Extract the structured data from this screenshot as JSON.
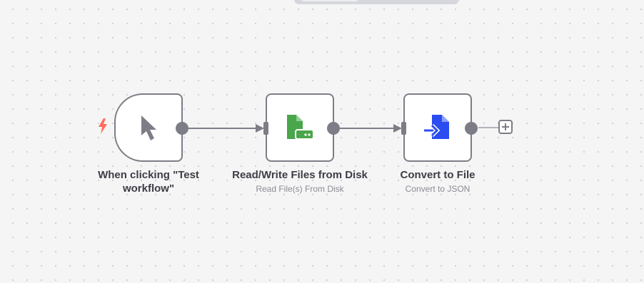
{
  "canvas": {
    "colors": {
      "background": "#f5f5f5",
      "grid_dot": "#cfcfd4",
      "node_border": "#7d7d87",
      "trigger_icon": "#7d7d87",
      "trigger_bolt": "#ff6d5a",
      "read_write_icon": "#4aa64a",
      "convert_icon": "#2a4cf0"
    }
  },
  "nodes": [
    {
      "title": "When clicking \"Test workflow\"",
      "subtitle": "",
      "icon": "cursor-pointer-icon",
      "trigger_icon": "lightning-bolt-icon"
    },
    {
      "title": "Read/Write Files from Disk",
      "subtitle": "Read File(s) From Disk",
      "icon": "file-disk-icon"
    },
    {
      "title": "Convert to File",
      "subtitle": "Convert to JSON",
      "icon": "file-convert-icon"
    }
  ],
  "add_node": {
    "icon": "plus-icon"
  }
}
